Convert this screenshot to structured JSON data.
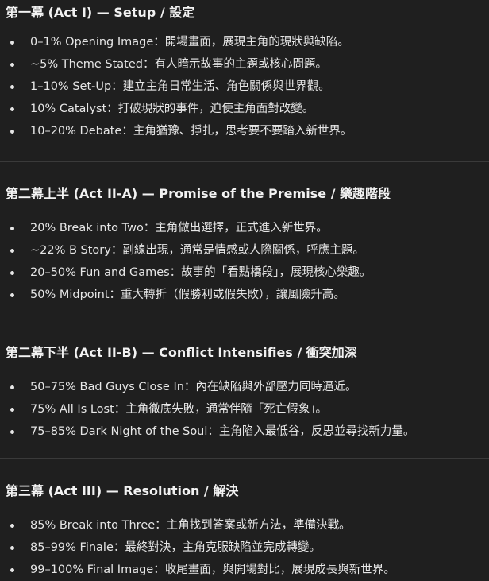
{
  "sections": [
    {
      "heading": "第一幕 (Act I) — Setup / 設定",
      "items": [
        "0–1% Opening Image：開場畫面，展現主角的現狀與缺陷。",
        "~5% Theme Stated：有人暗示故事的主題或核心問題。",
        "1–10% Set-Up：建立主角日常生活、角色關係與世界觀。",
        "10% Catalyst：打破現狀的事件，迫使主角面對改變。",
        "10–20% Debate：主角猶豫、掙扎，思考要不要踏入新世界。"
      ]
    },
    {
      "heading": "第二幕上半 (Act II-A) — Promise of the Premise / 樂趣階段",
      "items": [
        "20% Break into Two：主角做出選擇，正式進入新世界。",
        "~22% B Story：副線出現，通常是情感或人際關係，呼應主題。",
        "20–50% Fun and Games：故事的「看點橋段」，展現核心樂趣。",
        "50% Midpoint：重大轉折（假勝利或假失敗），讓風險升高。"
      ]
    },
    {
      "heading": "第二幕下半 (Act II-B) — Conflict Intensifies / 衝突加深",
      "items": [
        "50–75% Bad Guys Close In：內在缺陷與外部壓力同時逼近。",
        "75% All Is Lost：主角徹底失敗，通常伴隨「死亡假象」。",
        "75–85% Dark Night of the Soul：主角陷入最低谷，反思並尋找新力量。"
      ]
    },
    {
      "heading": "第三幕 (Act III) — Resolution / 解決",
      "items": [
        "85% Break into Three：主角找到答案或新方法，準備決戰。",
        "85–99% Finale：最終對決，主角克服缺陷並完成轉變。",
        "99–100% Final Image：收尾畫面，與開場對比，展現成長與新世界。"
      ]
    }
  ]
}
